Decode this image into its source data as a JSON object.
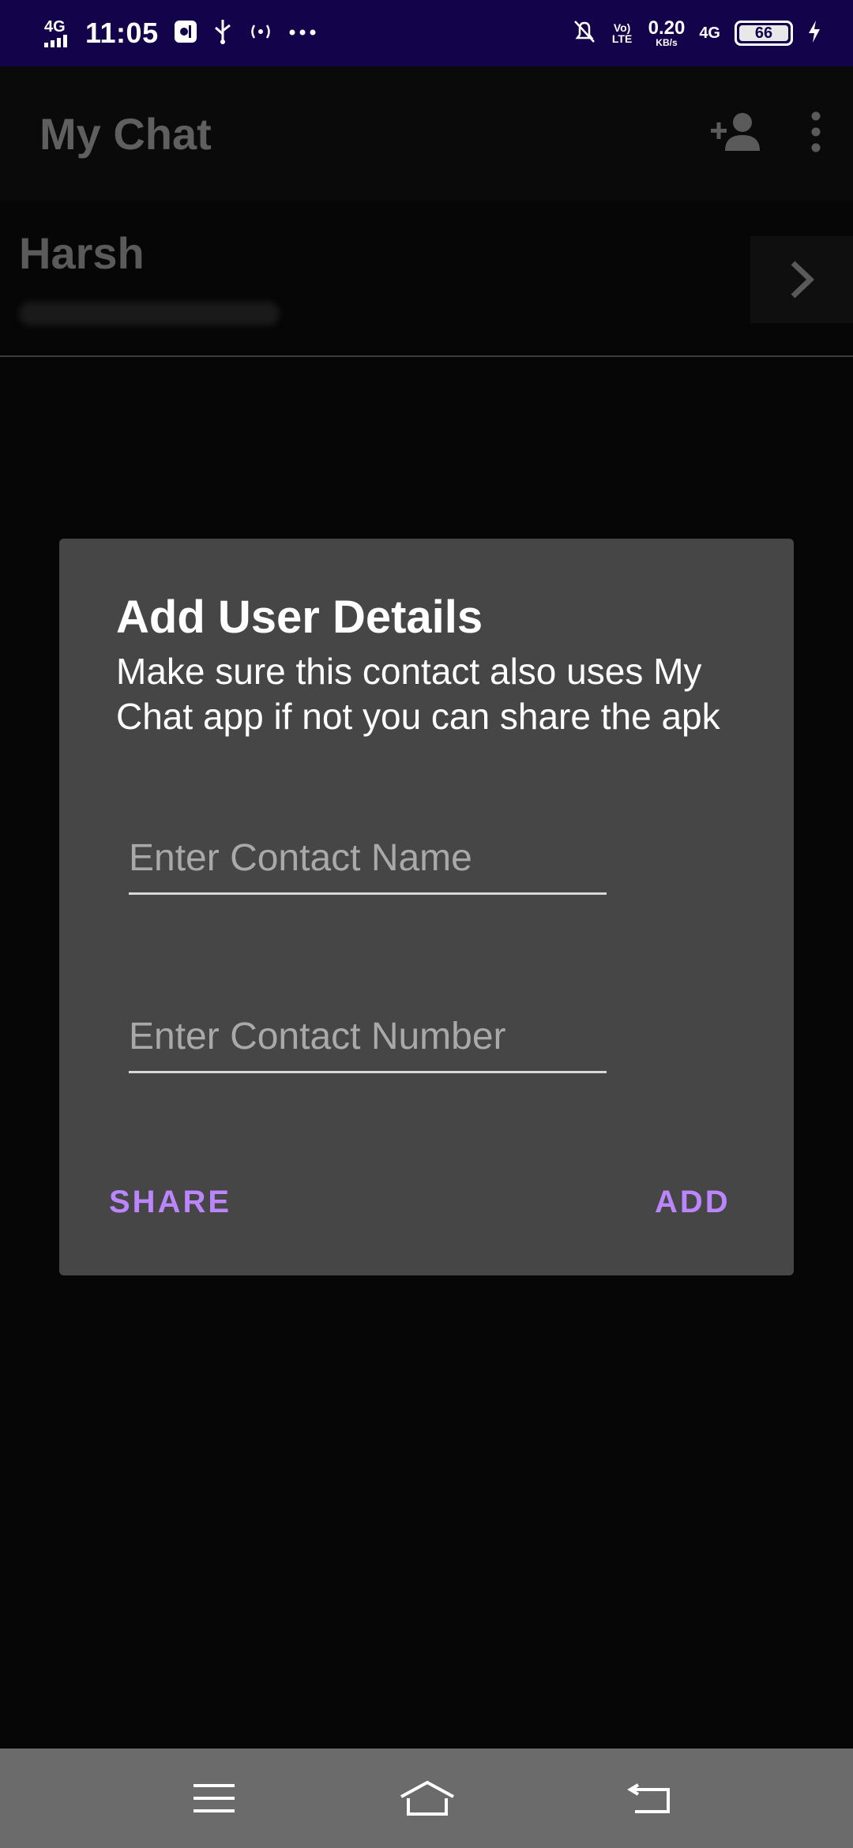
{
  "status_bar": {
    "network_left": "4G",
    "time": "11:05",
    "volte": "Vo) LTE",
    "speed": "0.20",
    "speed_unit": "KB/s",
    "network_right": "4G",
    "battery": "66",
    "icons": [
      "signal-icon",
      "usb-debug-icon",
      "usb-icon",
      "hotspot-icon",
      "more-dots-icon",
      "mute-notification-icon",
      "charging-icon"
    ]
  },
  "app_bar": {
    "title": "My Chat",
    "actions": [
      "add-contact-icon",
      "overflow-menu-icon"
    ]
  },
  "contact": {
    "name": "Harsh"
  },
  "dialog": {
    "title": "Add User Details",
    "message": "Make sure this contact also uses My Chat app if not you can share the apk",
    "name_field": {
      "value": "",
      "placeholder": "Enter Contact Name"
    },
    "number_field": {
      "value": "",
      "placeholder": "Enter Contact Number"
    },
    "share_label": "SHARE",
    "add_label": "ADD"
  },
  "nav_bar": {
    "items": [
      "menu-icon",
      "home-icon",
      "back-icon"
    ]
  },
  "colors": {
    "status_bar": "#13034a",
    "dialog_bg": "#464646",
    "accent": "#bb86fc",
    "scrim": "#060606"
  }
}
